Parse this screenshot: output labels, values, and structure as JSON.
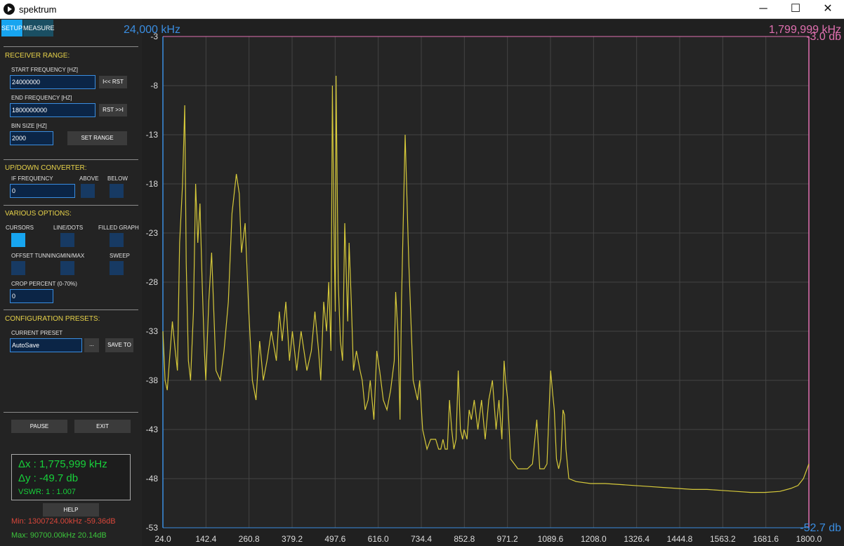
{
  "window": {
    "title": "spektrum",
    "minimize_glyph": "─",
    "maximize_glyph": "☐",
    "close_glyph": "✕"
  },
  "tabs": [
    {
      "label": "SETUP"
    },
    {
      "label": "MEASURE"
    }
  ],
  "colors": {
    "trace": "#d6c93a",
    "start_freq": "#3a8de0",
    "end_freq": "#e070b0",
    "grid": "#444444",
    "accent": "#17a5f0"
  },
  "receiver_range": {
    "title": "RECEIVER RANGE:",
    "start_label": "START FREQUENCY [HZ]",
    "start_value": "24000000",
    "start_reset": "I<< RST",
    "end_label": "END FREQUENCY [HZ]",
    "end_value": "1800000000",
    "end_reset": "RST >>I",
    "bin_label": "BIN SIZE [HZ]",
    "bin_value": "2000",
    "set_range": "SET RANGE"
  },
  "converter": {
    "title": "UP/DOWN CONVERTER:",
    "if_label": "IF FREQUENCY",
    "if_value": "0",
    "above_label": "ABOVE",
    "below_label": "BELOW"
  },
  "options": {
    "title": "VARIOUS OPTIONS:",
    "cursors": "CURSORS",
    "line_dots": "LINE/DOTS",
    "filled_graph": "FILLED GRAPH",
    "offset_tuning": "OFFSET TUNNING",
    "min_max": "MIN/MAX",
    "sweep": "SWEEP",
    "crop_label": "CROP PERCENT (0-70%)",
    "crop_value": "0"
  },
  "presets": {
    "title": "CONFIGURATION PRESETS:",
    "current_label": "CURRENT PRESET",
    "current_value": "AutoSave",
    "browse": "...",
    "save_to": "SAVE TO"
  },
  "actions": {
    "pause": "PAUSE",
    "exit": "EXIT",
    "help": "HELP"
  },
  "measure": {
    "dx": "Δx : 1,775,999 kHz",
    "dy": "Δy : -49.7 db",
    "vswr": "VSWR: 1 : 1.007"
  },
  "minmax": {
    "min": "Min: 1300724.00kHz -59.36dB",
    "max": "Max: 90700.00kHz 20.14dB"
  },
  "plot_labels": {
    "start_freq": "24,000 kHz",
    "end_freq": "1,799,999 kHz",
    "top_db": "-3.0 db",
    "bottom_db": "-52.7 db"
  },
  "chart_data": {
    "type": "line",
    "title": "",
    "xlabel": "",
    "ylabel": "",
    "xlim": [
      24.0,
      1800.0
    ],
    "ylim": [
      -53,
      -3
    ],
    "x_ticks": [
      "24.0",
      "142.4",
      "260.8",
      "379.2",
      "497.6",
      "616.0",
      "734.4",
      "852.8",
      "971.2",
      "1089.6",
      "1208.0",
      "1326.4",
      "1444.8",
      "1563.2",
      "1681.6",
      "1800.0"
    ],
    "y_ticks": [
      "-3",
      "-8",
      "-13",
      "-18",
      "-23",
      "-28",
      "-33",
      "-38",
      "-43",
      "-48",
      "-53"
    ],
    "grid": true,
    "series": [
      {
        "x": [
          24,
          30,
          36,
          42,
          50,
          58,
          64,
          70,
          78,
          84,
          88,
          94,
          100,
          108,
          114,
          120,
          126,
          132,
          138,
          142,
          150,
          158,
          170,
          182,
          192,
          204,
          214,
          226,
          234,
          240,
          250,
          260,
          270,
          280,
          290,
          300,
          310,
          322,
          336,
          344,
          352,
          362,
          372,
          380,
          392,
          404,
          420,
          432,
          442,
          452,
          458,
          466,
          474,
          480,
          486,
          490,
          494,
          498,
          500,
          506,
          512,
          518,
          524,
          528,
          532,
          536,
          542,
          548,
          556,
          566,
          572,
          580,
          588,
          594,
          604,
          612,
          620,
          630,
          640,
          650,
          660,
          664,
          670,
          676,
          680,
          690,
          700,
          712,
          724,
          730,
          738,
          744,
          750,
          760,
          774,
          782,
          788,
          794,
          800,
          806,
          812,
          818,
          824,
          830,
          836,
          842,
          848,
          852,
          860,
          866,
          872,
          880,
          890,
          900,
          910,
          920,
          930,
          940,
          948,
          956,
          962,
          966,
          972,
          980,
          990,
          1000,
          1012,
          1026,
          1040,
          1052,
          1060,
          1066,
          1072,
          1080,
          1090,
          1096,
          1100,
          1106,
          1112,
          1118,
          1124,
          1128,
          1132,
          1140,
          1160,
          1200,
          1240,
          1280,
          1320,
          1360,
          1400,
          1440,
          1480,
          1520,
          1560,
          1600,
          1640,
          1680,
          1720,
          1750,
          1770,
          1785,
          1800
        ],
        "y": [
          -33,
          -38,
          -39,
          -36,
          -32,
          -35,
          -37,
          -24,
          -18,
          -10,
          -26,
          -36,
          -38,
          -31,
          -18,
          -24,
          -20,
          -28,
          -35,
          -38,
          -30,
          -25,
          -37,
          -38,
          -35,
          -30,
          -21,
          -17,
          -19,
          -25,
          -22,
          -31,
          -38,
          -40,
          -34,
          -38,
          -36,
          -33,
          -36,
          -31,
          -34,
          -30,
          -36,
          -33,
          -37,
          -33,
          -37,
          -35,
          -31,
          -35,
          -38,
          -30,
          -33,
          -28,
          -35,
          -8,
          -22,
          -31,
          -7,
          -28,
          -34,
          -36,
          -22,
          -27,
          -32,
          -24,
          -30,
          -37,
          -35,
          -37,
          -38,
          -41,
          -40,
          -38,
          -42,
          -35,
          -37,
          -40,
          -41,
          -39,
          -36,
          -29,
          -33,
          -42,
          -30,
          -13,
          -26,
          -38,
          -40,
          -38,
          -43,
          -44,
          -45,
          -44,
          -44,
          -45,
          -45,
          -44,
          -45,
          -45,
          -40,
          -43,
          -45,
          -44,
          -37,
          -43,
          -44,
          -43,
          -44,
          -41,
          -42,
          -40,
          -43,
          -40,
          -44,
          -40,
          -38,
          -43,
          -40,
          -44,
          -36,
          -38,
          -40,
          -46,
          -46.5,
          -47,
          -47,
          -47,
          -46.5,
          -42,
          -47,
          -47,
          -47,
          -46.5,
          -37,
          -39.5,
          -41,
          -46,
          -47,
          -46,
          -41,
          -41.5,
          -45,
          -48,
          -48.3,
          -48.5,
          -48.5,
          -48.6,
          -48.7,
          -48.8,
          -48.9,
          -49,
          -49.1,
          -49.1,
          -49.2,
          -49.3,
          -49.4,
          -49.4,
          -49.3,
          -49,
          -48.7,
          -48,
          -46.5
        ]
      }
    ]
  }
}
